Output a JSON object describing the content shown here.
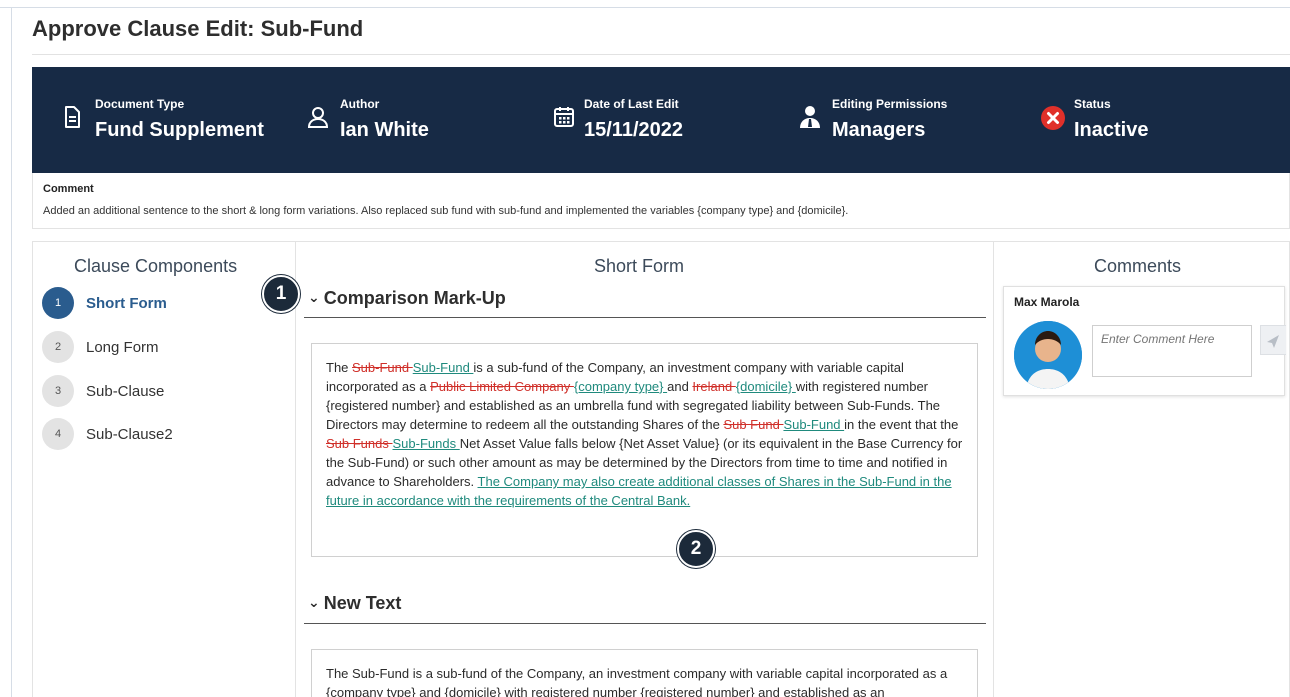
{
  "page": {
    "title": "Approve Clause Edit: Sub-Fund"
  },
  "banner": {
    "items": [
      {
        "label": "Document Type",
        "value": "Fund Supplement",
        "icon": "document-icon"
      },
      {
        "label": "Author",
        "value": "Ian White",
        "icon": "user-icon"
      },
      {
        "label": "Date of Last Edit",
        "value": "15/11/2022",
        "icon": "calendar-icon"
      },
      {
        "label": "Editing Permissions",
        "value": "Managers",
        "icon": "manager-icon"
      },
      {
        "label": "Status",
        "value": "Inactive",
        "icon": "status-error-icon"
      }
    ],
    "colors": {
      "background": "#172a45",
      "status_icon": "#e0302a"
    }
  },
  "comment": {
    "label": "Comment",
    "text": "Added an additional sentence to the short & long form variations. Also replaced sub fund with sub-fund and implemented the variables {company type} and {domicile}."
  },
  "clause_components": {
    "title": "Clause Components",
    "steps": [
      {
        "number": "1",
        "label": "Short Form",
        "active": true
      },
      {
        "number": "2",
        "label": "Long Form",
        "active": false
      },
      {
        "number": "3",
        "label": "Sub-Clause",
        "active": false
      },
      {
        "number": "4",
        "label": "Sub-Clause2",
        "active": false
      }
    ],
    "active_color": "#2a5c8e"
  },
  "short_form": {
    "title": "Short Form",
    "markup_section": {
      "heading": "Comparison Mark-Up",
      "segments": [
        {
          "t": "The ",
          "k": "n"
        },
        {
          "t": "Sub-Fund ",
          "k": "d"
        },
        {
          "t": "Sub-Fund ",
          "k": "i"
        },
        {
          "t": "is a sub-fund of the Company, an investment company with variable capital incorporated as a ",
          "k": "n"
        },
        {
          "t": "Public Limited Company ",
          "k": "d"
        },
        {
          "t": "{company type} ",
          "k": "i"
        },
        {
          "t": "and ",
          "k": "n"
        },
        {
          "t": "Ireland ",
          "k": "d"
        },
        {
          "t": "{domicile} ",
          "k": "i"
        },
        {
          "t": "with registered number {registered number} and established as an umbrella fund with segregated liability between Sub-Funds. The Directors may determine to redeem all the outstanding Shares of the ",
          "k": "n"
        },
        {
          "t": "Sub Fund ",
          "k": "d"
        },
        {
          "t": "Sub-Fund ",
          "k": "i"
        },
        {
          "t": "in the event that the ",
          "k": "n"
        },
        {
          "t": "Sub Funds ",
          "k": "d"
        },
        {
          "t": "Sub-Funds ",
          "k": "i"
        },
        {
          "t": "Net Asset Value falls below {Net Asset Value} (or its equivalent in the Base Currency for the Sub-Fund) or such other amount as may be determined by the Directors from time to time and notified in advance to Shareholders. ",
          "k": "n"
        },
        {
          "t": "The Company may also create additional classes of Shares in the Sub-Fund in the future in accordance with the requirements of the Central Bank.",
          "k": "i"
        }
      ]
    },
    "new_text_section": {
      "heading": "New Text",
      "text": "The Sub-Fund is a sub-fund of the Company, an investment company with variable capital incorporated as a {company type} and {domicile} with registered number {registered number} and established as an"
    },
    "colors": {
      "deleted": "#d0302a",
      "inserted": "#1f8a7d"
    }
  },
  "comments_panel": {
    "title": "Comments",
    "user": "Max Marola",
    "input_placeholder": "Enter Comment Here",
    "send_icon": "send-icon"
  },
  "markers": [
    "1",
    "2"
  ]
}
